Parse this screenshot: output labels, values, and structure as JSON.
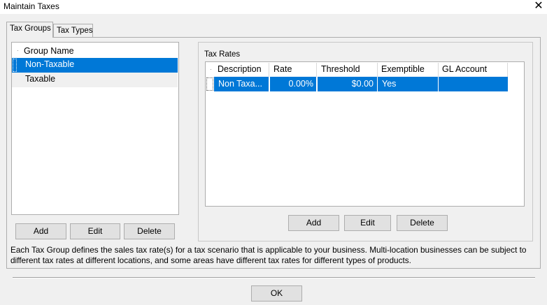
{
  "window": {
    "title": "Maintain Taxes",
    "close_glyph": "✕"
  },
  "tabs": [
    {
      "label": "Tax Groups",
      "active": true
    },
    {
      "label": "Tax Types",
      "active": false
    }
  ],
  "groups": {
    "header": "Group Name",
    "items": [
      {
        "label": "Non-Taxable",
        "selected": true
      },
      {
        "label": "Taxable",
        "selected": false
      }
    ],
    "buttons": {
      "add": "Add",
      "edit": "Edit",
      "delete": "Delete"
    }
  },
  "tax_rates": {
    "label": "Tax Rates",
    "columns": [
      "Description",
      "Rate",
      "Threshold",
      "Exemptible",
      "GL Account"
    ],
    "rows": [
      {
        "description": "Non Taxa...",
        "rate": "0.00%",
        "threshold": "$0.00",
        "exemptible": "Yes",
        "gl_account": ""
      }
    ],
    "buttons": {
      "add": "Add",
      "edit": "Edit",
      "delete": "Delete"
    }
  },
  "description": "Each Tax Group defines the sales tax rate(s) for a tax scenario that is applicable to your business. Multi-location businesses can be subject to different tax rates at different locations, and some areas have different tax rates for different types of products.",
  "footer": {
    "ok": "OK"
  },
  "colors": {
    "selection": "#0078d7",
    "window_bg": "#f0f0f0"
  }
}
